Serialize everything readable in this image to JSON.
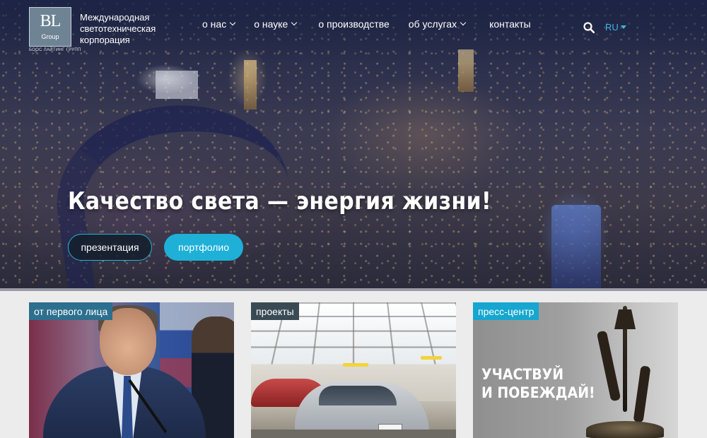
{
  "logo": {
    "mark": "BL",
    "group": "Group",
    "subtitle": "БООС ЛАЙТИНГ ГРУПП"
  },
  "brand": {
    "line1": "Международная",
    "line2": "светотехническая",
    "line3": "корпорация"
  },
  "nav": {
    "items": [
      {
        "label": "о нас",
        "has_dropdown": true
      },
      {
        "label": "о науке",
        "has_dropdown": true
      },
      {
        "label": "о производстве",
        "has_dropdown": false
      },
      {
        "label": "об услугах",
        "has_dropdown": true
      },
      {
        "label": "контакты",
        "has_dropdown": false
      }
    ],
    "search_icon": "search-icon",
    "language": "RU"
  },
  "hero": {
    "headline": "Качество света — энергия жизни!",
    "buttons": {
      "presentation": "презентация",
      "portfolio": "портфолио"
    }
  },
  "cards": [
    {
      "label": "от первого лица"
    },
    {
      "label": "проекты"
    },
    {
      "label": "пресс-центр",
      "text_line1": "УЧАСТВУЙ",
      "text_line2": "И ПОБЕЖДАЙ!"
    }
  ],
  "colors": {
    "accent": "#1fb0d8",
    "lang": "#3db6e6",
    "label_dark": "#2d6f8e"
  }
}
